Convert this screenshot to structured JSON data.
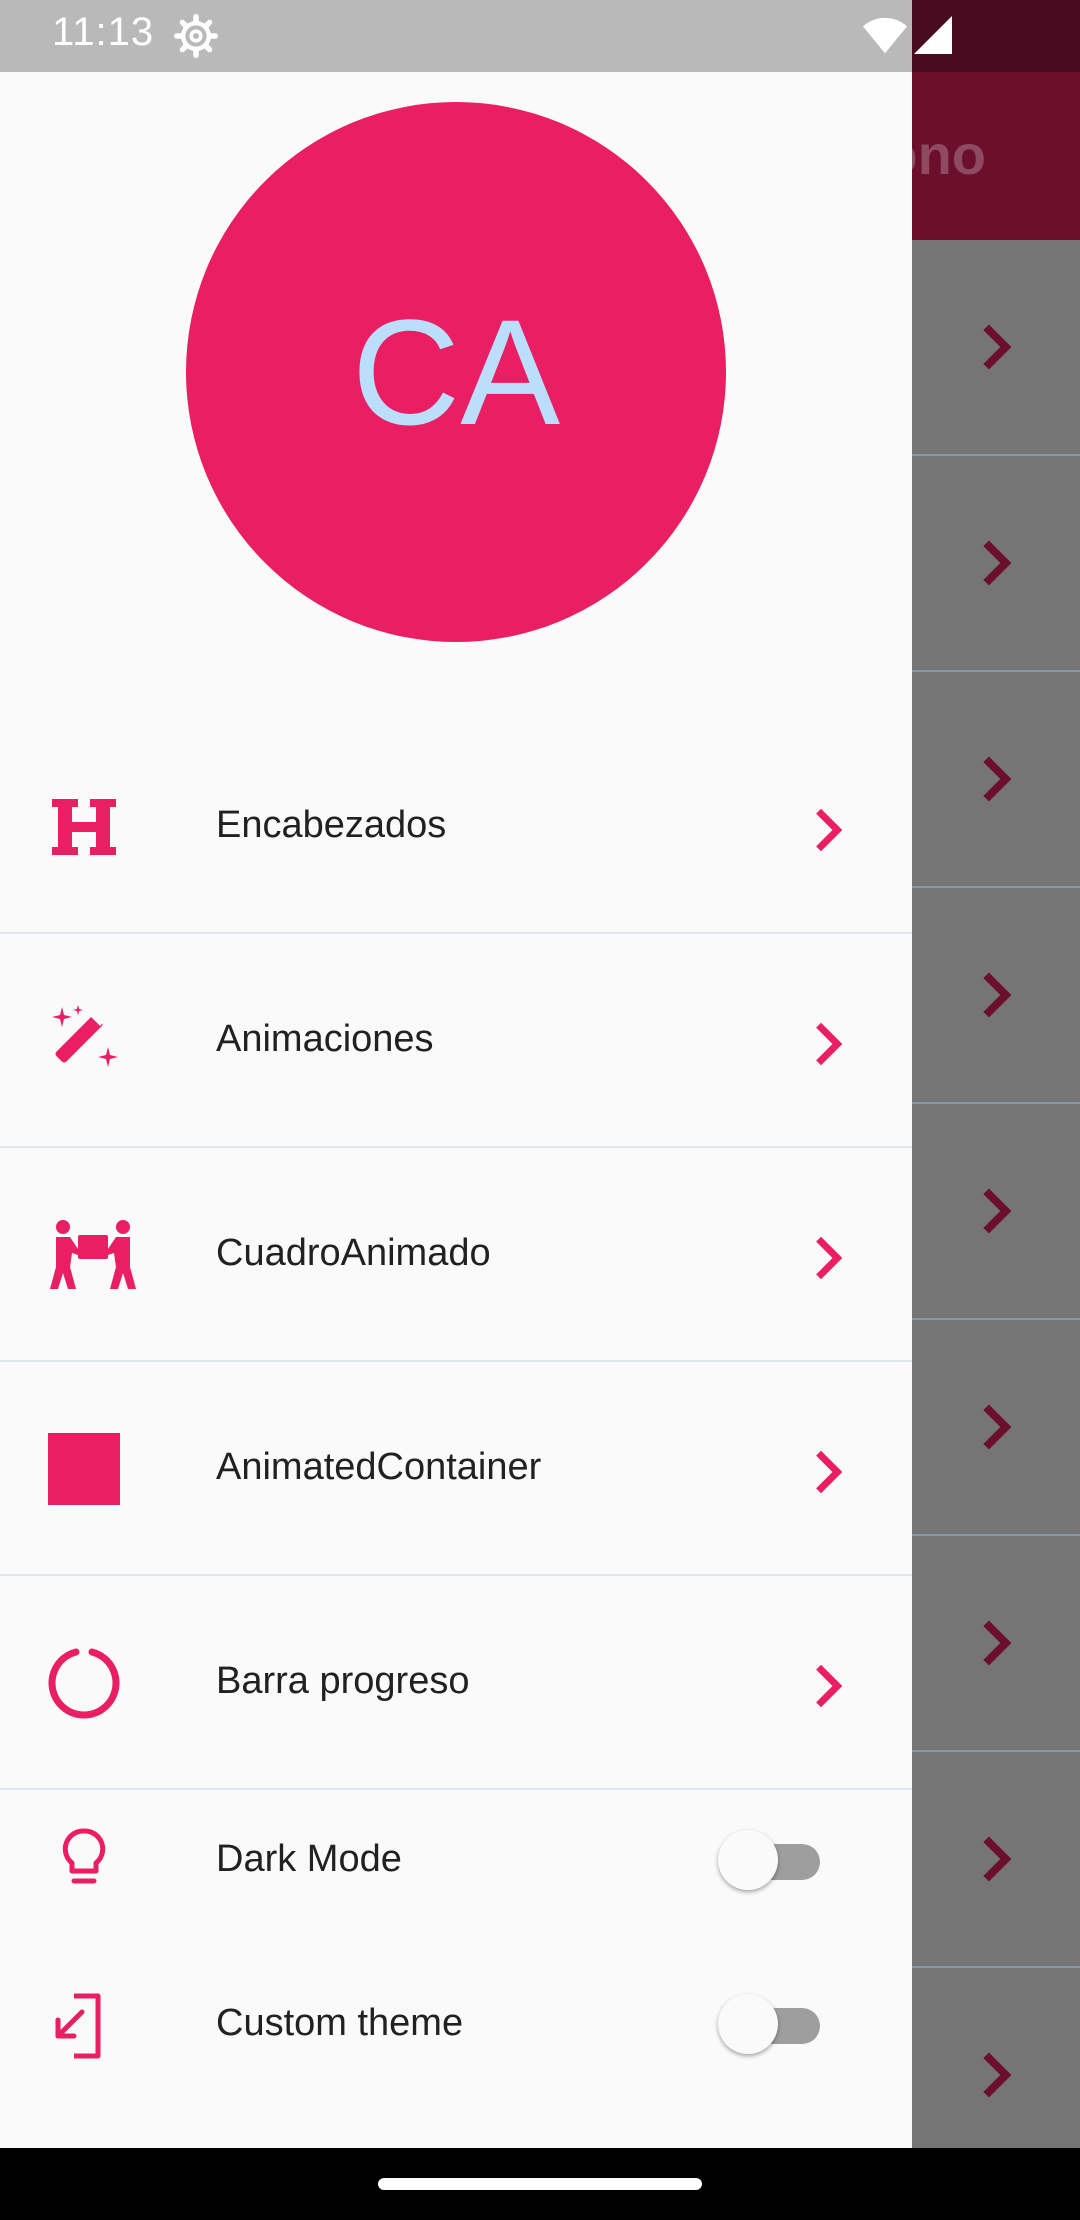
{
  "status_bar": {
    "time": "11:13",
    "icons": [
      "settings-gear-icon",
      "wifi-icon",
      "cell-signal-icon"
    ]
  },
  "background_app": {
    "title_fragment": "ono",
    "row_count": 9,
    "appbar_color": "#6b0f2d"
  },
  "drawer": {
    "avatar": {
      "initials": "CA",
      "bg_color": "#e91e63",
      "text_color": "#bbdefb"
    },
    "items": [
      {
        "label": "Encabezados",
        "icon": "heading-h-icon"
      },
      {
        "label": "Animaciones",
        "icon": "magic-wand-icon"
      },
      {
        "label": "CuadroAnimado",
        "icon": "people-carry-box-icon"
      },
      {
        "label": "AnimatedContainer",
        "icon": "square-icon"
      },
      {
        "label": "Barra progreso",
        "icon": "circle-notch-icon"
      }
    ],
    "toggles": [
      {
        "label": "Dark Mode",
        "icon": "lightbulb-icon",
        "on": false
      },
      {
        "label": "Custom theme",
        "icon": "login-arrow-icon",
        "on": false
      }
    ]
  },
  "colors": {
    "accent": "#e91e63",
    "scrim": "#757575"
  }
}
